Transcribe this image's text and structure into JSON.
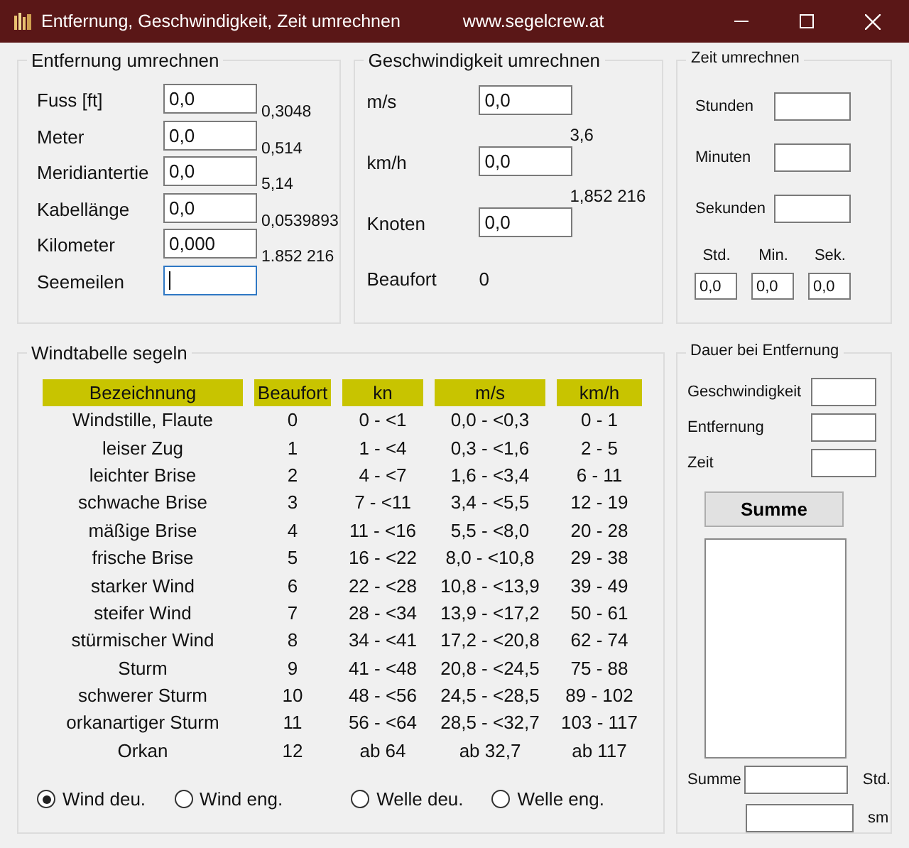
{
  "window": {
    "title": "Entfernung, Geschwindigkeit, Zeit umrechnen",
    "url": "www.segelcrew.at"
  },
  "distance": {
    "title": "Entfernung umrechnen",
    "rows": [
      {
        "label": "Fuss [ft]",
        "value": "0,0",
        "factor": "0,3048",
        "focused": false
      },
      {
        "label": "Meter",
        "value": "0,0",
        "factor": "0,514",
        "focused": false
      },
      {
        "label": "Meridiantertie",
        "value": "0,0",
        "factor": "5,14",
        "focused": false
      },
      {
        "label": "Kabellänge",
        "value": "0,0",
        "factor": "0,0539893",
        "focused": false
      },
      {
        "label": "Kilometer",
        "value": "0,000",
        "factor": "1.852 216",
        "focused": false
      },
      {
        "label": "Seemeilen",
        "focused": true
      }
    ]
  },
  "speed": {
    "title": "Geschwindigkeit umrechnen",
    "rows": [
      {
        "label": "m/s",
        "value": "0,0",
        "factor": "3,6"
      },
      {
        "label": "km/h",
        "value": "0,0",
        "factor": "1,852 216"
      },
      {
        "label": "Knoten",
        "value": "0,0"
      }
    ],
    "beaufort": {
      "label": "Beaufort",
      "value": "0"
    }
  },
  "time": {
    "title": "Zeit umrechnen",
    "fields": [
      {
        "label": "Stunden"
      },
      {
        "label": "Minuten"
      },
      {
        "label": "Sekunden"
      }
    ],
    "units": [
      {
        "label": "Std.",
        "value": "0,0"
      },
      {
        "label": "Min.",
        "value": "0,0"
      },
      {
        "label": "Sek.",
        "value": "0,0"
      }
    ]
  },
  "wind_table": {
    "title": "Windtabelle segeln",
    "columns": [
      "Bezeichnung",
      "Beaufort",
      "kn",
      "m/s",
      "km/h"
    ],
    "rows": [
      [
        "Windstille, Flaute",
        "0",
        "0 - <1",
        "0,0 - <0,3",
        "0 - 1"
      ],
      [
        "leiser Zug",
        "1",
        "1 - <4",
        "0,3 - <1,6",
        "2 - 5"
      ],
      [
        "leichter Brise",
        "2",
        "4 - <7",
        "1,6 - <3,4",
        "6 - 11"
      ],
      [
        "schwache Brise",
        "3",
        "7 - <11",
        "3,4 - <5,5",
        "12 - 19"
      ],
      [
        "mäßige Brise",
        "4",
        "11 - <16",
        "5,5 - <8,0",
        "20 - 28"
      ],
      [
        "frische Brise",
        "5",
        "16 - <22",
        "8,0 - <10,8",
        "29 - 38"
      ],
      [
        "starker Wind",
        "6",
        "22 - <28",
        "10,8 - <13,9",
        "39 - 49"
      ],
      [
        "steifer Wind",
        "7",
        "28 - <34",
        "13,9 - <17,2",
        "50 - 61"
      ],
      [
        "stürmischer Wind",
        "8",
        "34 - <41",
        "17,2 - <20,8",
        "62 - 74"
      ],
      [
        "Sturm",
        "9",
        "41 - <48",
        "20,8 - <24,5",
        "75 - 88"
      ],
      [
        "schwerer Sturm",
        "10",
        "48 - <56",
        "24,5 - <28,5",
        "89 - 102"
      ],
      [
        "orkanartiger Sturm",
        "11",
        "56 - <64",
        "28,5 - <32,7",
        "103 - 117"
      ],
      [
        "Orkan",
        "12",
        "ab 64",
        "ab 32,7",
        "ab 117"
      ]
    ],
    "radios": [
      {
        "label": "Wind deu.",
        "selected": true
      },
      {
        "label": "Wind eng.",
        "selected": false
      },
      {
        "label": "Welle deu.",
        "selected": false
      },
      {
        "label": "Welle eng.",
        "selected": false
      }
    ]
  },
  "duration": {
    "title": "Dauer bei Entfernung",
    "fields": [
      {
        "label": "Geschwindigkeit"
      },
      {
        "label": "Entfernung"
      },
      {
        "label": "Zeit"
      }
    ],
    "button": "Summe",
    "totals": [
      {
        "label": "Summe",
        "unit": "Std."
      },
      {
        "unit": "sm"
      }
    ]
  }
}
